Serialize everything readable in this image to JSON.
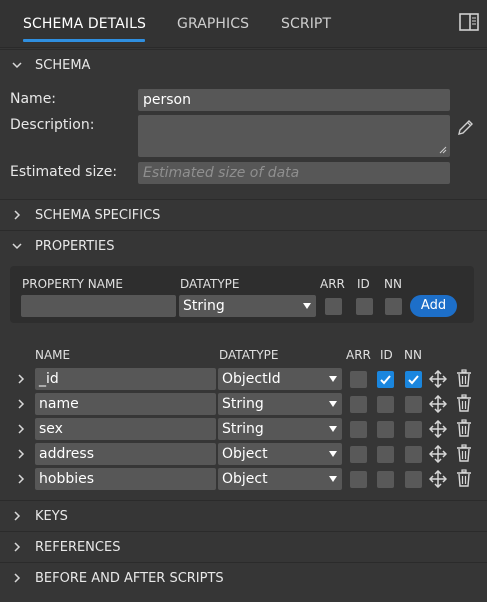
{
  "tabs": [
    {
      "label": "SCHEMA DETAILS",
      "active": true
    },
    {
      "label": "GRAPHICS",
      "active": false
    },
    {
      "label": "SCRIPT",
      "active": false
    }
  ],
  "sections": {
    "schema": "SCHEMA",
    "schema_specifics": "SCHEMA SPECIFICS",
    "properties": "PROPERTIES",
    "keys": "KEYS",
    "references": "REFERENCES",
    "scripts": "BEFORE AND AFTER SCRIPTS"
  },
  "schema": {
    "name_label": "Name:",
    "name_value": "person",
    "description_label": "Description:",
    "description_value": "",
    "size_label": "Estimated size:",
    "size_placeholder": "Estimated size of data"
  },
  "add_property": {
    "headers": {
      "name": "PROPERTY NAME",
      "datatype": "DATATYPE",
      "arr": "ARR",
      "id": "ID",
      "nn": "NN"
    },
    "name_value": "",
    "datatype_value": "String",
    "add_label": "Add"
  },
  "property_table": {
    "headers": {
      "name": "NAME",
      "datatype": "DATATYPE",
      "arr": "ARR",
      "id": "ID",
      "nn": "NN"
    },
    "rows": [
      {
        "name": "_id",
        "datatype": "ObjectId",
        "arr": false,
        "id": true,
        "nn": true
      },
      {
        "name": "name",
        "datatype": "String",
        "arr": false,
        "id": false,
        "nn": false
      },
      {
        "name": "sex",
        "datatype": "String",
        "arr": false,
        "id": false,
        "nn": false
      },
      {
        "name": "address",
        "datatype": "Object",
        "arr": false,
        "id": false,
        "nn": false
      },
      {
        "name": "hobbies",
        "datatype": "Object",
        "arr": false,
        "id": false,
        "nn": false
      }
    ]
  },
  "icons": {
    "panel": "panel-toggle-icon",
    "edit": "pencil-icon",
    "move": "move-icon",
    "delete": "trash-icon"
  },
  "colors": {
    "accent": "#2f8fe0",
    "button": "#1d6fc9",
    "checkbox_checked": "#1a86de",
    "background": "#363636",
    "field": "#575757"
  }
}
